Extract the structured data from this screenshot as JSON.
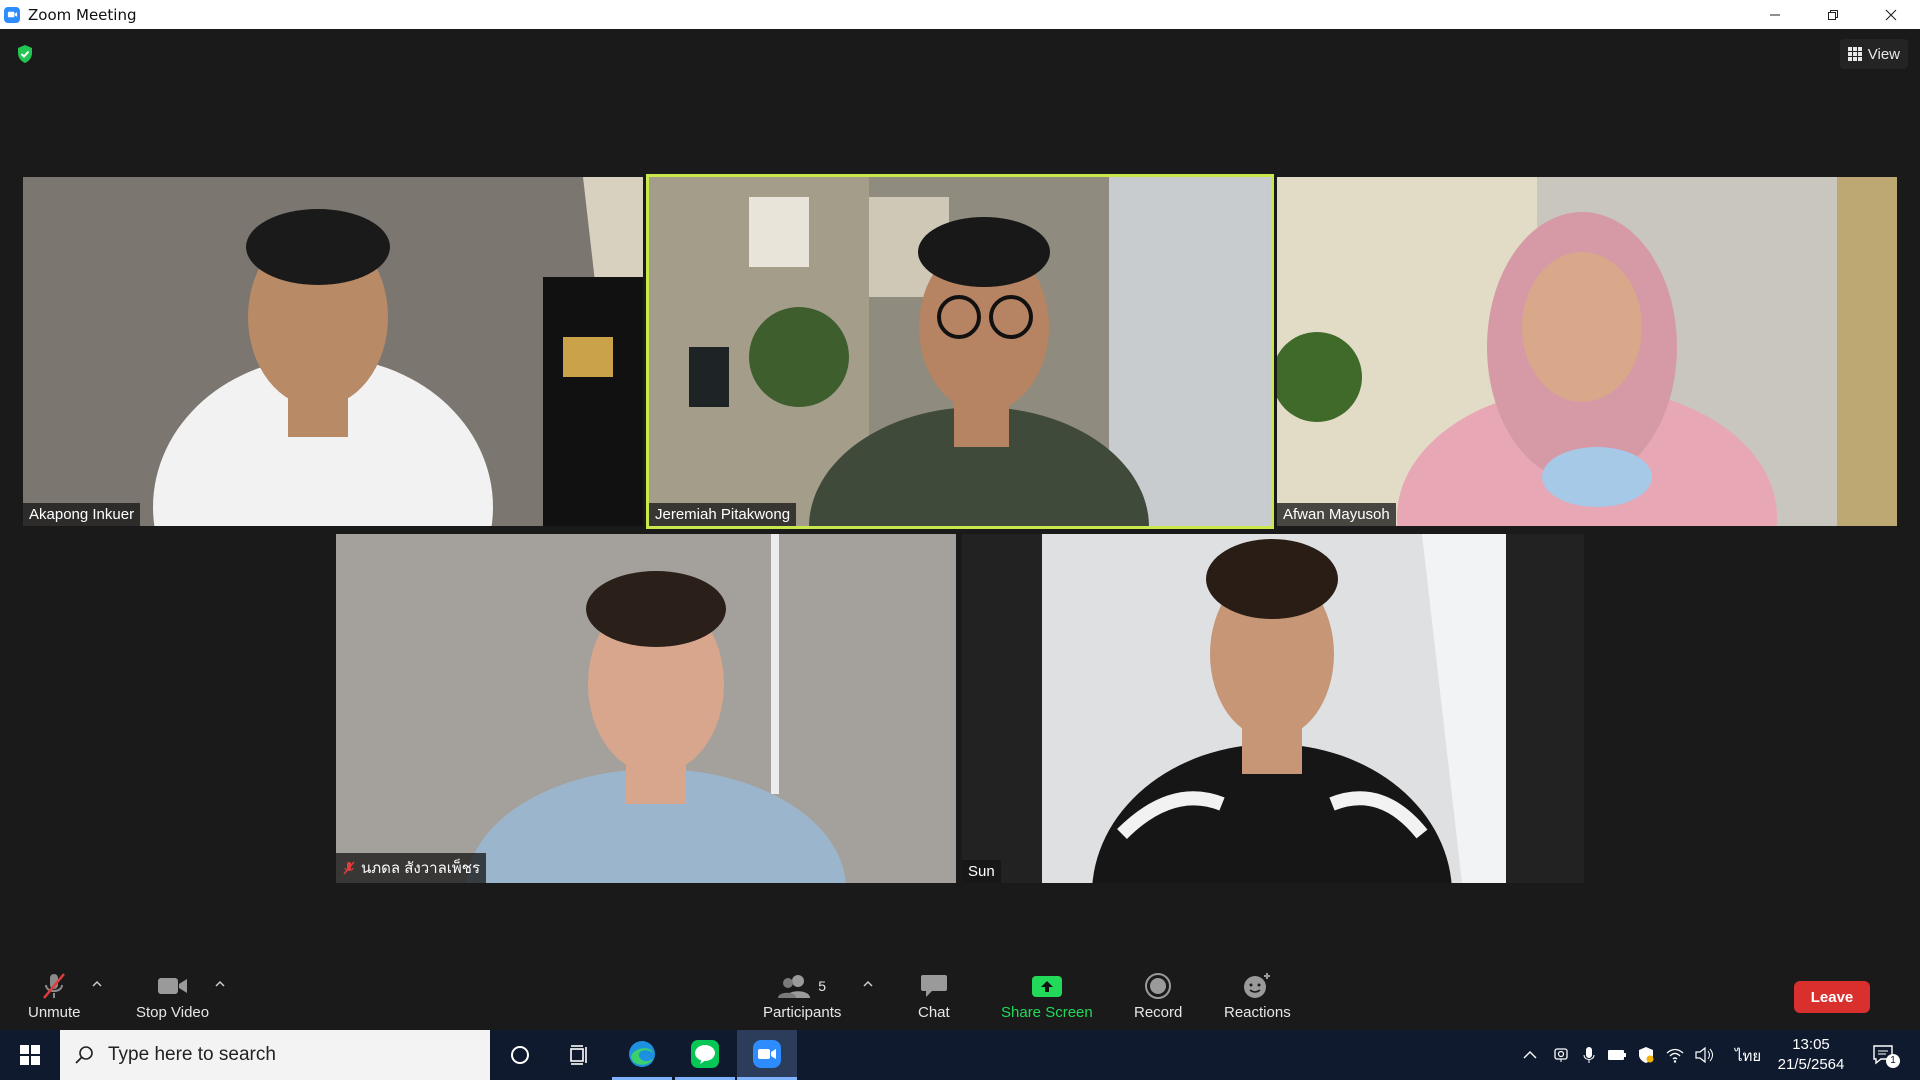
{
  "window": {
    "title": "Zoom Meeting"
  },
  "top_right": {
    "view_label": "View"
  },
  "participants": [
    {
      "name": "Akapong Inkuer",
      "muted": false,
      "speaking": false,
      "bg": "#6e6a64",
      "skin": "#b98a66",
      "shirt": "#f2f2f2"
    },
    {
      "name": "Jeremiah Pitakwong",
      "muted": false,
      "speaking": true,
      "bg": "#8a8a7c",
      "skin": "#b68463",
      "shirt": "#3f4a3a"
    },
    {
      "name": "Afwan Mayusoh",
      "muted": false,
      "speaking": false,
      "bg": "#c9c6bd",
      "skin": "#d9a78a",
      "shirt": "#e7a7b4"
    },
    {
      "name": "นภดล สังวาลเพ็ชร",
      "muted": true,
      "speaking": false,
      "bg": "#a4a19d",
      "skin": "#d8a68c",
      "shirt": "#9bb6cc"
    },
    {
      "name": "Sun",
      "muted": false,
      "speaking": false,
      "bg": "#dfe0e2",
      "skin": "#c69676",
      "shirt": "#161616"
    }
  ],
  "toolbar": {
    "unmute_label": "Unmute",
    "stop_video_label": "Stop Video",
    "participants_label": "Participants",
    "participants_count": "5",
    "chat_label": "Chat",
    "share_label": "Share Screen",
    "record_label": "Record",
    "reactions_label": "Reactions",
    "leave_label": "Leave",
    "share_color": "#23d959",
    "leave_color": "#d9302e"
  },
  "taskbar": {
    "search_placeholder": "Type here to search",
    "language": "ไทย",
    "time": "13:05",
    "date": "21/5/2564",
    "notification_count": "1"
  }
}
